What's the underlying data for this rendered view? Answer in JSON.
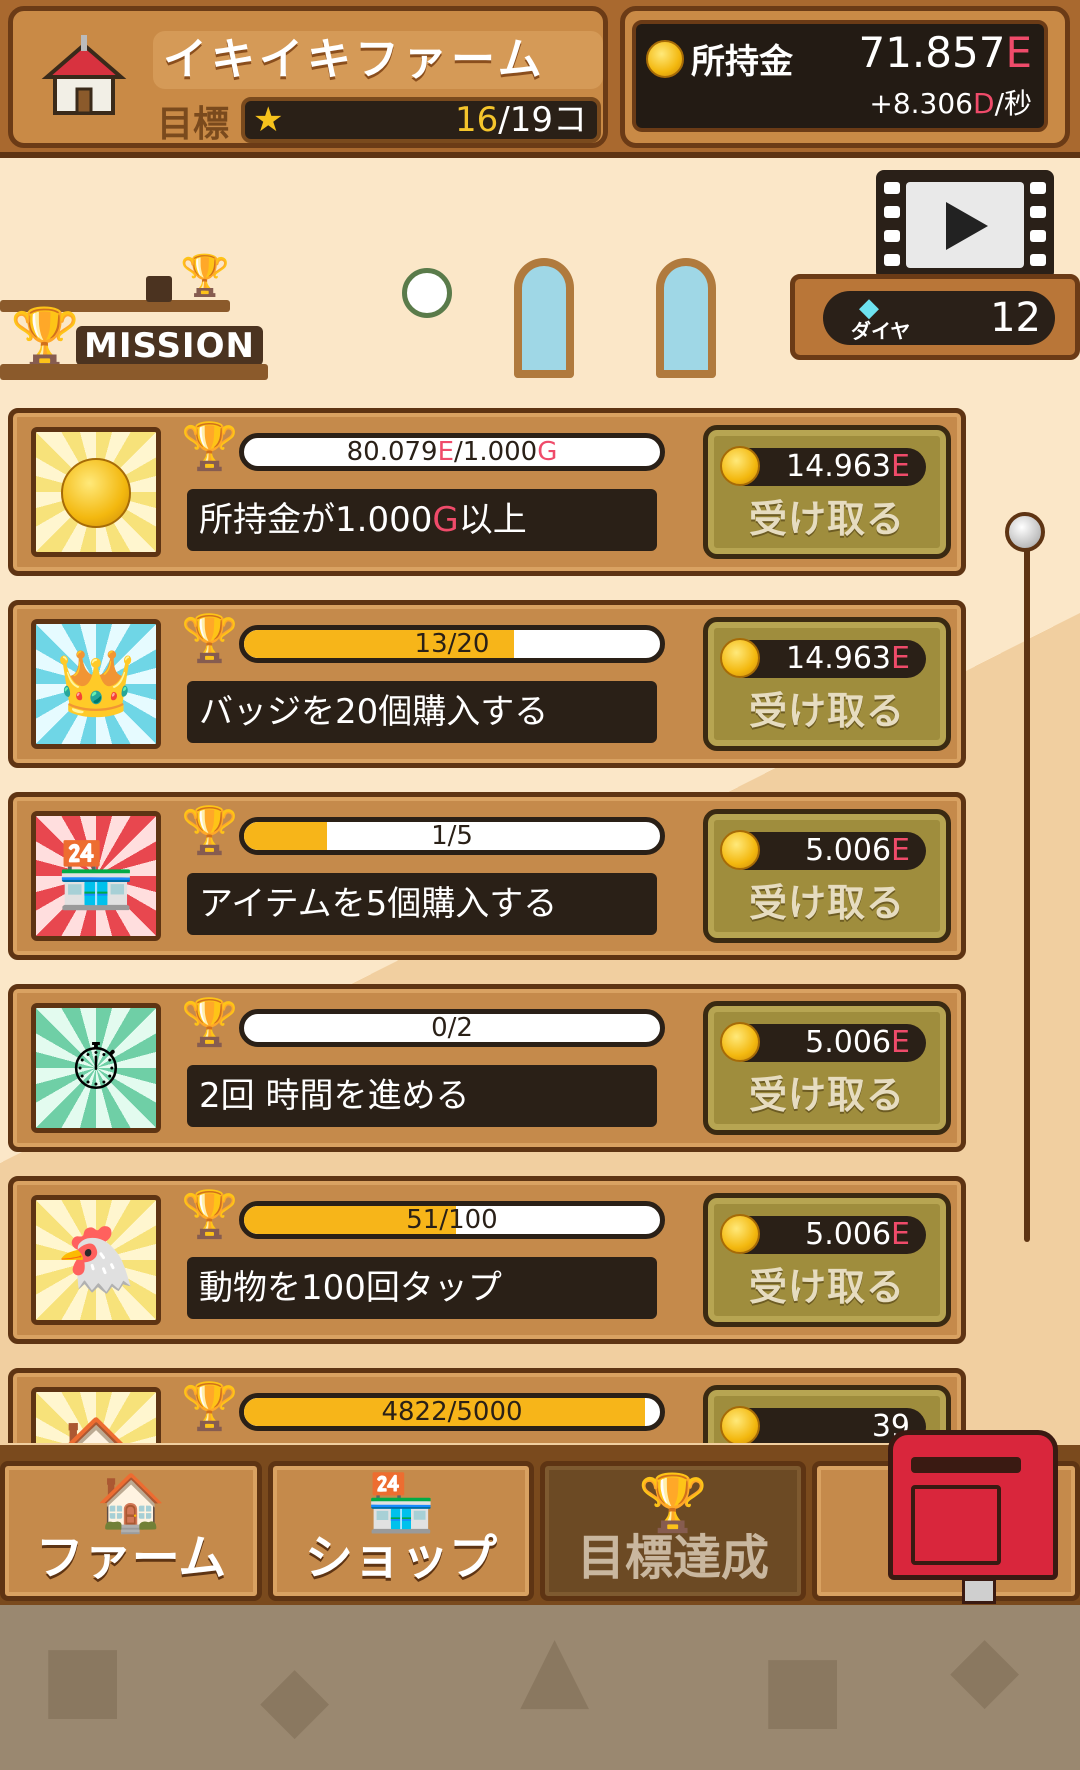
{
  "header": {
    "farm_name": "イキイキファーム",
    "goal_label": "目標",
    "goal_current": "16",
    "goal_total": "/19コ",
    "money_label": "所持金",
    "money_value": "71.857",
    "money_unit": "E",
    "rate_prefix": "+8.306",
    "rate_unit": "D",
    "rate_suffix": "/秒"
  },
  "scene": {
    "mission_label": "MISSION",
    "diamond_label": "ダイヤ",
    "diamond_count": "12"
  },
  "colors": {
    "accent_unit": "#ef4b6a",
    "progress_fill": "#f7b519",
    "panel_brown": "#c58a4b"
  },
  "missions": [
    {
      "icon": "coin-icon",
      "progress_text": "80.079",
      "progress_unit": "E",
      "progress_sep": "/1.000",
      "progress_unit2": "G",
      "progress": 0.0,
      "title_a": "所持金が1.000",
      "title_unit": "G",
      "title_b": "以上",
      "reward": "14.963",
      "reward_unit": "E",
      "claim": "受け取る"
    },
    {
      "icon": "badge-icon",
      "progress_text": "13/20",
      "progress": 0.65,
      "title_a": "バッジを20個購入する",
      "reward": "14.963",
      "reward_unit": "E",
      "claim": "受け取る"
    },
    {
      "icon": "shop-icon",
      "progress_text": "1/5",
      "progress": 0.2,
      "title_a": "アイテムを5個購入する",
      "reward": "5.006",
      "reward_unit": "E",
      "claim": "受け取る"
    },
    {
      "icon": "clock-icon",
      "progress_text": "0/2",
      "progress": 0.0,
      "title_a": "2回 時間を進める",
      "reward": "5.006",
      "reward_unit": "E",
      "claim": "受け取る"
    },
    {
      "icon": "chicken-icon",
      "progress_text": "51/100",
      "progress": 0.51,
      "title_a": "動物を100回タップ",
      "reward": "5.006",
      "reward_unit": "E",
      "claim": "受け取る"
    },
    {
      "icon": "farm-icon",
      "progress_text": "4822/5000",
      "progress": 0.964,
      "title_a": "",
      "reward": "39",
      "reward_unit": "",
      "claim": ""
    }
  ],
  "nav": {
    "farm": "ファーム",
    "shop": "ショップ",
    "goals": "目標達成"
  }
}
